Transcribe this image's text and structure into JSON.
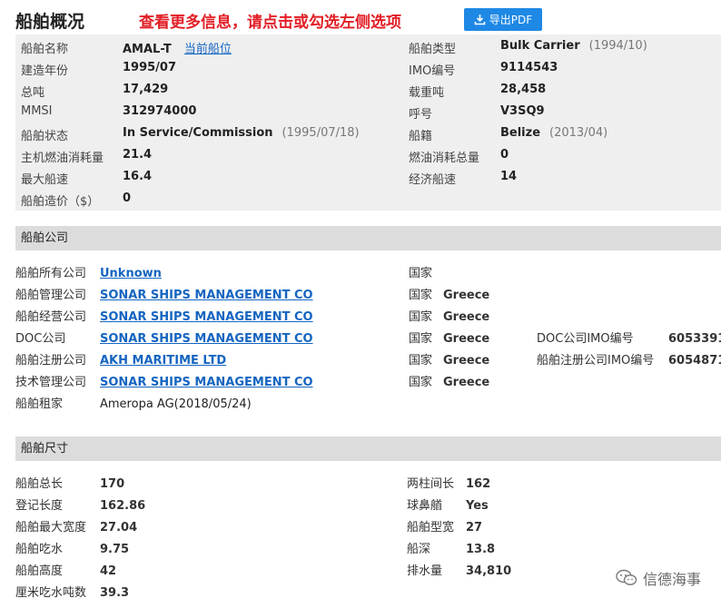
{
  "header": {
    "title": "船舶概况",
    "notice": "查看更多信息，请点击或勾选左侧选项",
    "pdf_button": "导出PDF"
  },
  "overview": {
    "rows": [
      {
        "l1": "船舶名称",
        "v1": "AMAL-T",
        "v1_link": "当前船位",
        "l2": "船舶类型",
        "v2": "Bulk Carrier",
        "v2_sub": "(1994/10)"
      },
      {
        "l1": "建造年份",
        "v1": "1995/07",
        "l2": "IMO编号",
        "v2": "9114543"
      },
      {
        "l1": "总吨",
        "v1": "17,429",
        "l2": "载重吨",
        "v2": "28,458"
      },
      {
        "l1": "MMSI",
        "v1": "312974000",
        "l2": "呼号",
        "v2": "V3SQ9"
      },
      {
        "l1": "船舶状态",
        "v1": "In Service/Commission",
        "v1_sub": "(1995/07/18)",
        "l2": "船籍",
        "v2": "Belize",
        "v2_sub": "(2013/04)"
      },
      {
        "l1": "主机燃油消耗量",
        "v1": "21.4",
        "l2": "燃油消耗总量",
        "v2": "0"
      },
      {
        "l1": "最大船速",
        "v1": "16.4",
        "l2": "经济船速",
        "v2": "14"
      },
      {
        "l1": "船舶造价（$）",
        "v1": "0"
      }
    ]
  },
  "company": {
    "section_title": "船舶公司",
    "rows": [
      {
        "label": "船舶所有公司",
        "name": "Unknown",
        "country_label": "国家",
        "country": ""
      },
      {
        "label": "船舶管理公司",
        "name": "SONAR SHIPS MANAGEMENT CO",
        "country_label": "国家",
        "country": "Greece"
      },
      {
        "label": "船舶经营公司",
        "name": "SONAR SHIPS MANAGEMENT CO",
        "country_label": "国家",
        "country": "Greece"
      },
      {
        "label": "DOC公司",
        "name": "SONAR SHIPS MANAGEMENT CO",
        "country_label": "国家",
        "country": "Greece",
        "extra_label": "DOC公司IMO编号",
        "extra_value": "6053391"
      },
      {
        "label": "船舶注册公司",
        "name": "AKH MARITIME LTD",
        "country_label": "国家",
        "country": "Greece",
        "extra_label": "船舶注册公司IMO编号",
        "extra_value": "6054871"
      },
      {
        "label": "技术管理公司",
        "name": "SONAR SHIPS MANAGEMENT CO",
        "country_label": "国家",
        "country": "Greece"
      }
    ],
    "charterer_label": "船舶租家",
    "charterer_value": "Ameropa AG(2018/05/24)"
  },
  "dimensions": {
    "section_title": "船舶尺寸",
    "rows": [
      {
        "l1": "船舶总长",
        "v1": "170",
        "l2": "两柱间长",
        "v2": "162"
      },
      {
        "l1": "登记长度",
        "v1": "162.86",
        "l2": "球鼻艏",
        "v2": "Yes"
      },
      {
        "l1": "船舶最大宽度",
        "v1": "27.04",
        "l2": "船舶型宽",
        "v2": "27"
      },
      {
        "l1": "船舶吃水",
        "v1": "9.75",
        "l2": "船深",
        "v2": "13.8"
      },
      {
        "l1": "船舶高度",
        "v1": "42",
        "l2": "排水量",
        "v2": "34,810"
      },
      {
        "l1": "厘米吃水吨数",
        "v1": "39.3"
      }
    ]
  },
  "watermark": "信德海事",
  "colors": {
    "accent": "#1e88e5",
    "notice": "#e21e26",
    "link": "#1565c0",
    "panel": "#efefef",
    "section": "#dcdcdc"
  }
}
